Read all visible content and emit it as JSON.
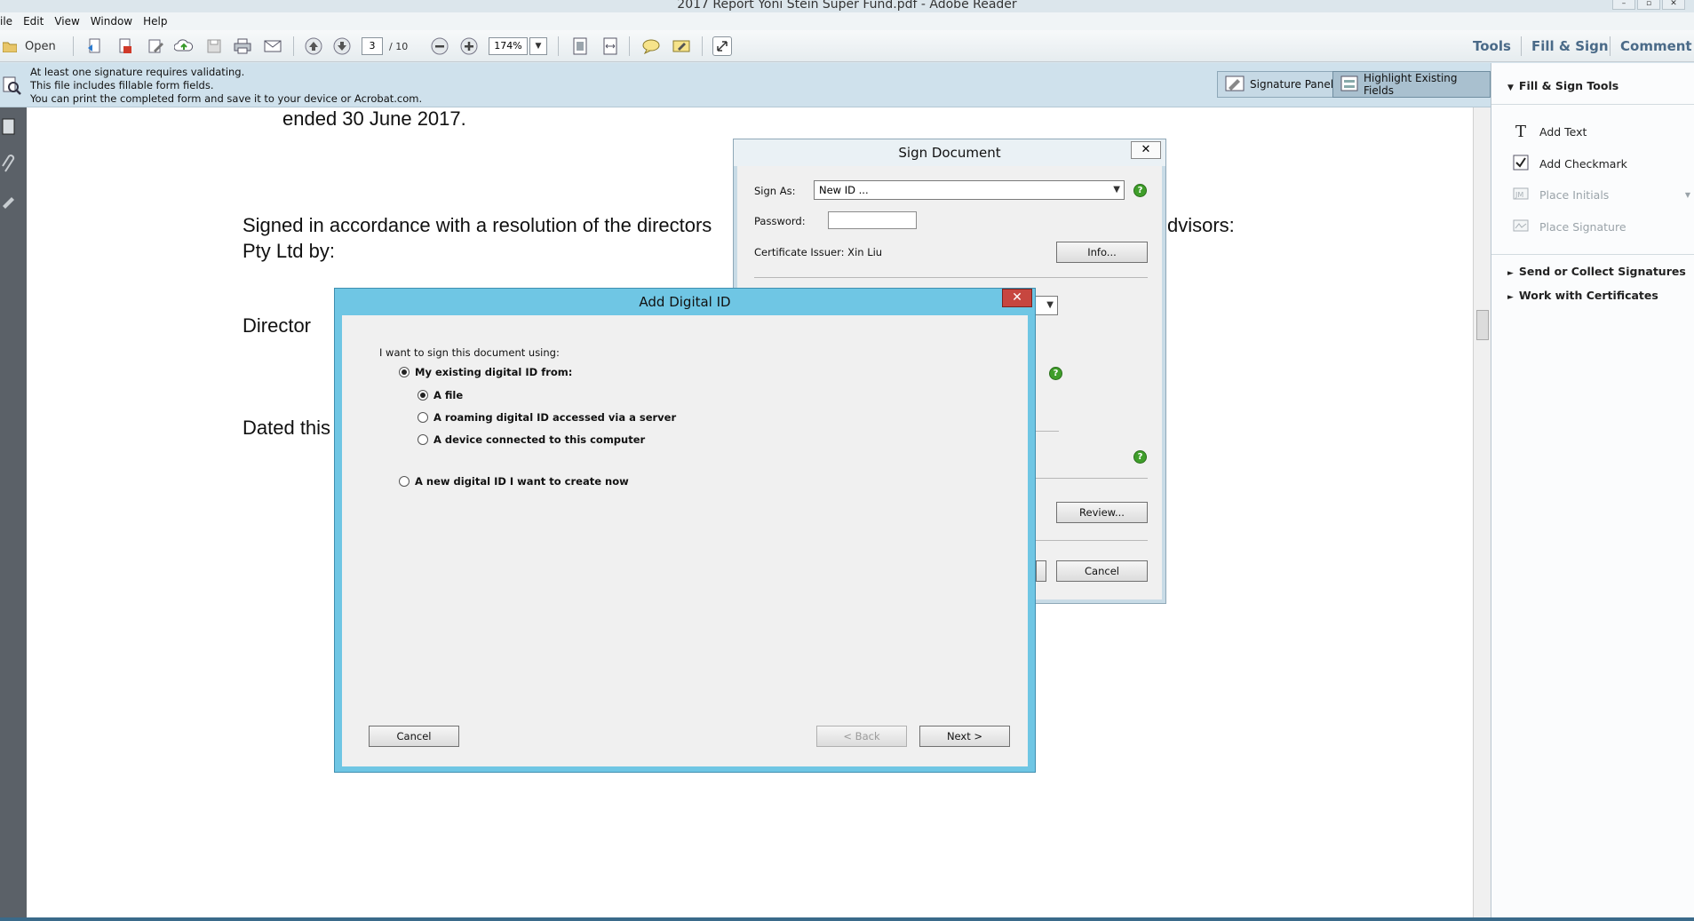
{
  "window": {
    "title": "2017 Report Yoni Stein Super Fund.pdf - Adobe Reader"
  },
  "menu": [
    "ile",
    "Edit",
    "View",
    "Window",
    "Help"
  ],
  "toolbar": {
    "open_label": "Open",
    "current_page": "3",
    "page_total": "/ 10",
    "zoom": "174%",
    "tools": "Tools",
    "fill_sign": "Fill & Sign",
    "comment": "Comment"
  },
  "infobar": {
    "line1": "At least one signature requires validating.",
    "line2": "This file includes fillable form fields.",
    "line3": "You can print the completed form and save it to your device or Acrobat.com.",
    "signature_panel": "Signature Panel",
    "highlight_fields": "Highlight Existing Fields"
  },
  "document": {
    "line1": "ended 30 June 2017.",
    "line2a": "Signed in accordance with a resolution of the directors",
    "line2b": "dvisors:",
    "line3": "Pty Ltd by:",
    "line4": "Director",
    "line5": "Dated this"
  },
  "right_panel": {
    "header": "Fill & Sign Tools",
    "add_text": "Add Text",
    "add_checkmark": "Add Checkmark",
    "place_initials": "Place Initials",
    "place_signature": "Place Signature",
    "send_collect": "Send or Collect Signatures",
    "certificates": "Work with Certificates"
  },
  "sign_dialog": {
    "title": "Sign Document",
    "close": "✕",
    "sign_as_label": "Sign As:",
    "sign_as_value": "New ID ...",
    "password_label": "Password:",
    "cert_issuer": "Certificate Issuer: Xin Liu",
    "info_button": "Info...",
    "review_button": "Review...",
    "cancel_button": "Cancel"
  },
  "add_id_dialog": {
    "title": "Add Digital ID",
    "close": "✕",
    "prompt": "I want to sign this document using:",
    "opt_existing": "My existing digital ID from:",
    "opt_file": "A file",
    "opt_roaming": "A roaming digital ID accessed via a server",
    "opt_device": "A device connected to this computer",
    "opt_new": "A new digital ID I want to create now",
    "cancel_button": "Cancel",
    "back_button": "< Back",
    "next_button": "Next >",
    "selected_source": "A file"
  }
}
